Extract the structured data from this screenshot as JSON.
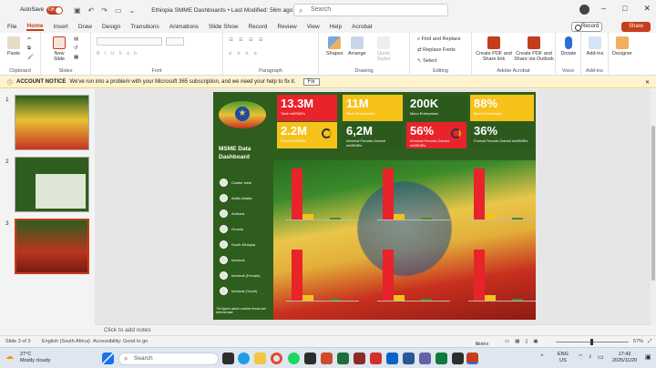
{
  "title_bar": {
    "autosave_label": "AutoSave",
    "autosave_state": "Off",
    "doc_title": "Ethiopia SMME Dashboards • Last Modified: 56m ago",
    "search_placeholder": "Search"
  },
  "tabs": [
    "File",
    "Home",
    "Insert",
    "Draw",
    "Design",
    "Transitions",
    "Animations",
    "Slide Show",
    "Record",
    "Review",
    "View",
    "Help",
    "Acrobat"
  ],
  "active_tab": "Home",
  "record_label": "Record",
  "share_label": "Share",
  "ribbon": {
    "paste": "Paste",
    "clipboard": "Clipboard",
    "new_slide": "New Slide",
    "slides": "Slides",
    "font": "Font",
    "paragraph": "Paragraph",
    "shapes": "Shapes",
    "arrange": "Arrange",
    "quick_styles": "Quick Styles",
    "drawing": "Drawing",
    "find_replace": "Find and Replace",
    "replace_fonts": "Replace Fonts",
    "select": "Select",
    "editing": "Editing",
    "create_pdf_link": "Create PDF and Share link",
    "create_pdf_outlook": "Create PDF and Share via Outlook",
    "adobe_acrobat": "Adobe Acrobat",
    "dictate": "Dictate",
    "voice": "Voice",
    "addins": "Add-ins",
    "addins_group": "Add-ins",
    "designer": "Designer"
  },
  "notice": {
    "label": "ACCOUNT NOTICE",
    "text": "We've run into a problem with your Microsoft 365 subscription, and we need your help to fix it.",
    "fix_button": "Fix"
  },
  "thumbnails": [
    "1",
    "2",
    "3"
  ],
  "slide": {
    "dashboard_title": "MSME Data Dashboard",
    "nav": [
      "Cluster wide",
      "Addis Ababa",
      "Amhara",
      "Oromia",
      "South Ethiopia",
      "Informal",
      "Informal (Female)",
      "Informal (Youth)"
    ],
    "footer_note": "The figures above combine formal and informal data",
    "cards": [
      {
        "value": "13.3M",
        "label": "Total mMSMEs",
        "color": "#e8232a"
      },
      {
        "value": "11M",
        "label": "Micro Enterprises",
        "color": "#f6c21a"
      },
      {
        "value": "200K",
        "label": "Micro Enterprises",
        "color": "#2c5a1c"
      },
      {
        "value": "88%",
        "label": "Micro Enterprises",
        "color": "#f6c21a"
      },
      {
        "value": "2.2M",
        "label": "Formal MSMEs",
        "color": "#f6c21a"
      },
      {
        "value": "6,2M",
        "label": "Informal Female-Owned mMSMEs",
        "color": "#2c5a1c"
      },
      {
        "value": "56%",
        "label": "Informal Female-Owned mMSMEs",
        "color": "#e8232a"
      },
      {
        "value": "36%",
        "label": "Formal Female-Owned mMSMEs",
        "color": "#2c5a1c"
      }
    ]
  },
  "notes_placeholder": "Click to add notes",
  "status_bar": {
    "slide_info": "Slide 3 of 3",
    "language": "English (South Africa)",
    "accessibility": "Accessibility: Good to go",
    "notes": "Notes",
    "zoom": "57%"
  },
  "taskbar": {
    "weather_temp": "27°C",
    "weather_desc": "Mostly cloudy",
    "search": "Search",
    "lang": "ENG",
    "region": "US",
    "time": "17:42",
    "date": "2025/11/20"
  }
}
